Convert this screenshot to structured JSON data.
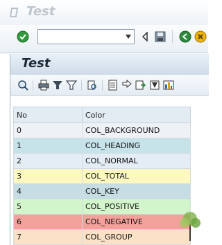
{
  "window": {
    "title": "Test"
  },
  "toolbar": {
    "command_field": {
      "value": "",
      "placeholder": ""
    },
    "buttons": [
      "enter-button",
      "back-button",
      "save-button",
      "exit-button",
      "cancel-button"
    ]
  },
  "screen": {
    "title": "Test"
  },
  "alv_toolbar": {
    "buttons": [
      "details-button",
      "print-button",
      "filter-set-button",
      "filter-button",
      "find-button",
      "export-button",
      "sort-button",
      "layout-button",
      "local-file-button",
      "excel-button"
    ]
  },
  "table": {
    "headers": {
      "no": "No",
      "color": "Color"
    },
    "rows": [
      {
        "no": "0",
        "color": "COL_BACKGROUND",
        "bg": "#eef2f6"
      },
      {
        "no": "1",
        "color": "COL_HEADING",
        "bg": "#c7e3ea"
      },
      {
        "no": "2",
        "color": "COL_NORMAL",
        "bg": "#e4edf5"
      },
      {
        "no": "3",
        "color": "COL_TOTAL",
        "bg": "#fdf8bf"
      },
      {
        "no": "4",
        "color": "COL_KEY",
        "bg": "#c6dde3"
      },
      {
        "no": "5",
        "color": "COL_POSITIVE",
        "bg": "#d2f5cb"
      },
      {
        "no": "6",
        "color": "COL_NEGATIVE",
        "bg": "#f2a29a"
      },
      {
        "no": "7",
        "color": "COL_GROUP",
        "bg": "#fbe2c6"
      }
    ]
  },
  "colors": {
    "accent": "#1f5fa8",
    "header_bg": "#e3ebf3"
  }
}
